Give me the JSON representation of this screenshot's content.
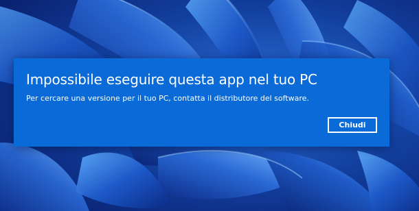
{
  "dialog": {
    "title": "Impossibile eseguire questa app nel tuo PC",
    "message": "Per cercare una versione per il tuo PC, contatta il distributore del software.",
    "close_label": "Chiudi"
  },
  "wallpaper": {
    "name": "windows-11-bloom-icon",
    "colors": {
      "deep": "#0b1f6e",
      "mid": "#1a4fc0",
      "light": "#3c8ef0",
      "highlight": "#8cc6ff"
    }
  },
  "colors": {
    "dialog_background": "#0a6bd8",
    "text": "#ffffff"
  }
}
